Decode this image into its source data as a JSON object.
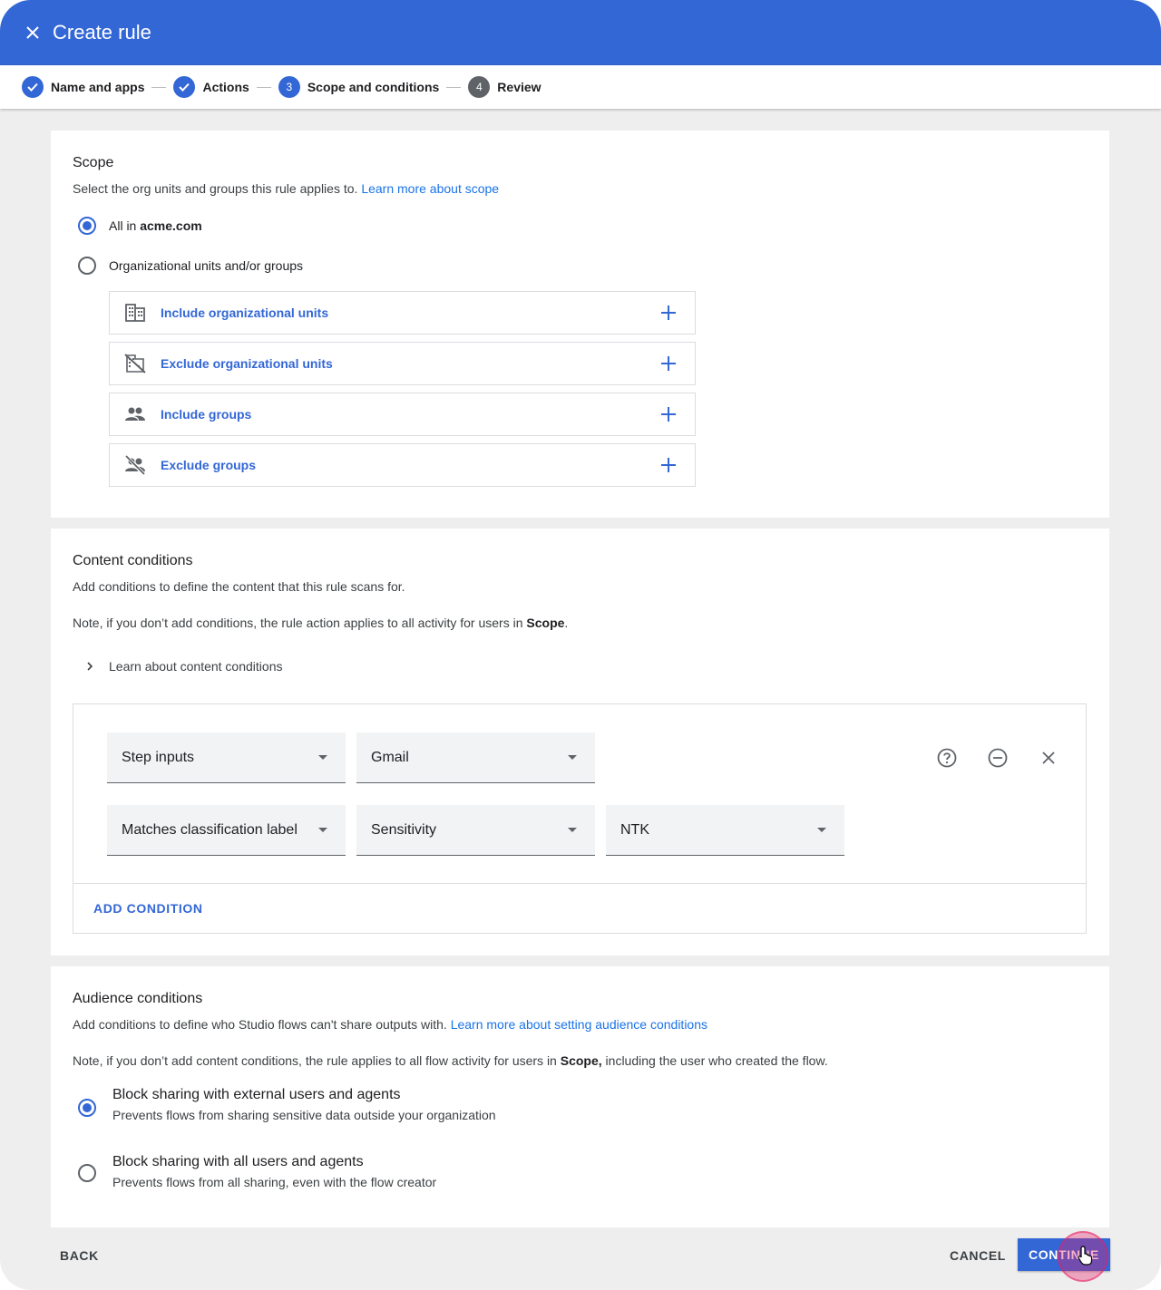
{
  "header": {
    "title": "Create rule",
    "close_icon": "close-icon"
  },
  "stepper": {
    "steps": [
      {
        "label": "Name and apps",
        "state": "done"
      },
      {
        "label": "Actions",
        "state": "done"
      },
      {
        "label": "Scope and conditions",
        "state": "current",
        "number": "3"
      },
      {
        "label": "Review",
        "state": "todo",
        "number": "4"
      }
    ]
  },
  "scope": {
    "title": "Scope",
    "description": "Select the org units and groups this rule applies to. ",
    "learn_more": "Learn more about scope",
    "options": [
      {
        "prefix": "All in ",
        "strong": "acme.com",
        "selected": true
      },
      {
        "label": "Organizational units and/or groups",
        "selected": false
      }
    ],
    "pickers": [
      {
        "label": "Include organizational units",
        "icon": "building-icon"
      },
      {
        "label": "Exclude organizational units",
        "icon": "building-off-icon"
      },
      {
        "label": "Include groups",
        "icon": "group-icon"
      },
      {
        "label": "Exclude groups",
        "icon": "group-off-icon"
      }
    ]
  },
  "content": {
    "title": "Content conditions",
    "description": "Add conditions to define the content that this rule scans for.",
    "note_prefix": "Note, if you don’t add conditions, the rule action applies to all activity for users in ",
    "note_strong": "Scope",
    "note_suffix": ".",
    "learn_toggle": "Learn about content conditions",
    "row1": {
      "field": "Step inputs",
      "value": "Gmail"
    },
    "row2": {
      "field": "Matches classification label",
      "label": "Sensitivity",
      "value": "NTK"
    },
    "add_condition": "ADD CONDITION"
  },
  "audience": {
    "title": "Audience conditions",
    "description": "Add conditions to define who Studio flows can't share outputs with. ",
    "learn_more": "Learn more about setting audience conditions",
    "note_prefix": "Note, if you don’t add content conditions, the rule applies to all flow activity for users in ",
    "note_strong": "Scope,",
    "note_suffix": " including the user who created the flow.",
    "options": [
      {
        "title": "Block sharing with external users and agents",
        "subtitle": "Prevents flows from sharing sensitive data outside your organization",
        "selected": true
      },
      {
        "title": "Block sharing with all users and agents",
        "subtitle": "Prevents flows from all sharing, even with the flow creator",
        "selected": false
      }
    ]
  },
  "footer": {
    "back": "BACK",
    "cancel": "CANCEL",
    "continue": "CONTINUE"
  },
  "colors": {
    "primary": "#3367d6",
    "link": "#1a73e8",
    "background": "#eeeeee"
  }
}
